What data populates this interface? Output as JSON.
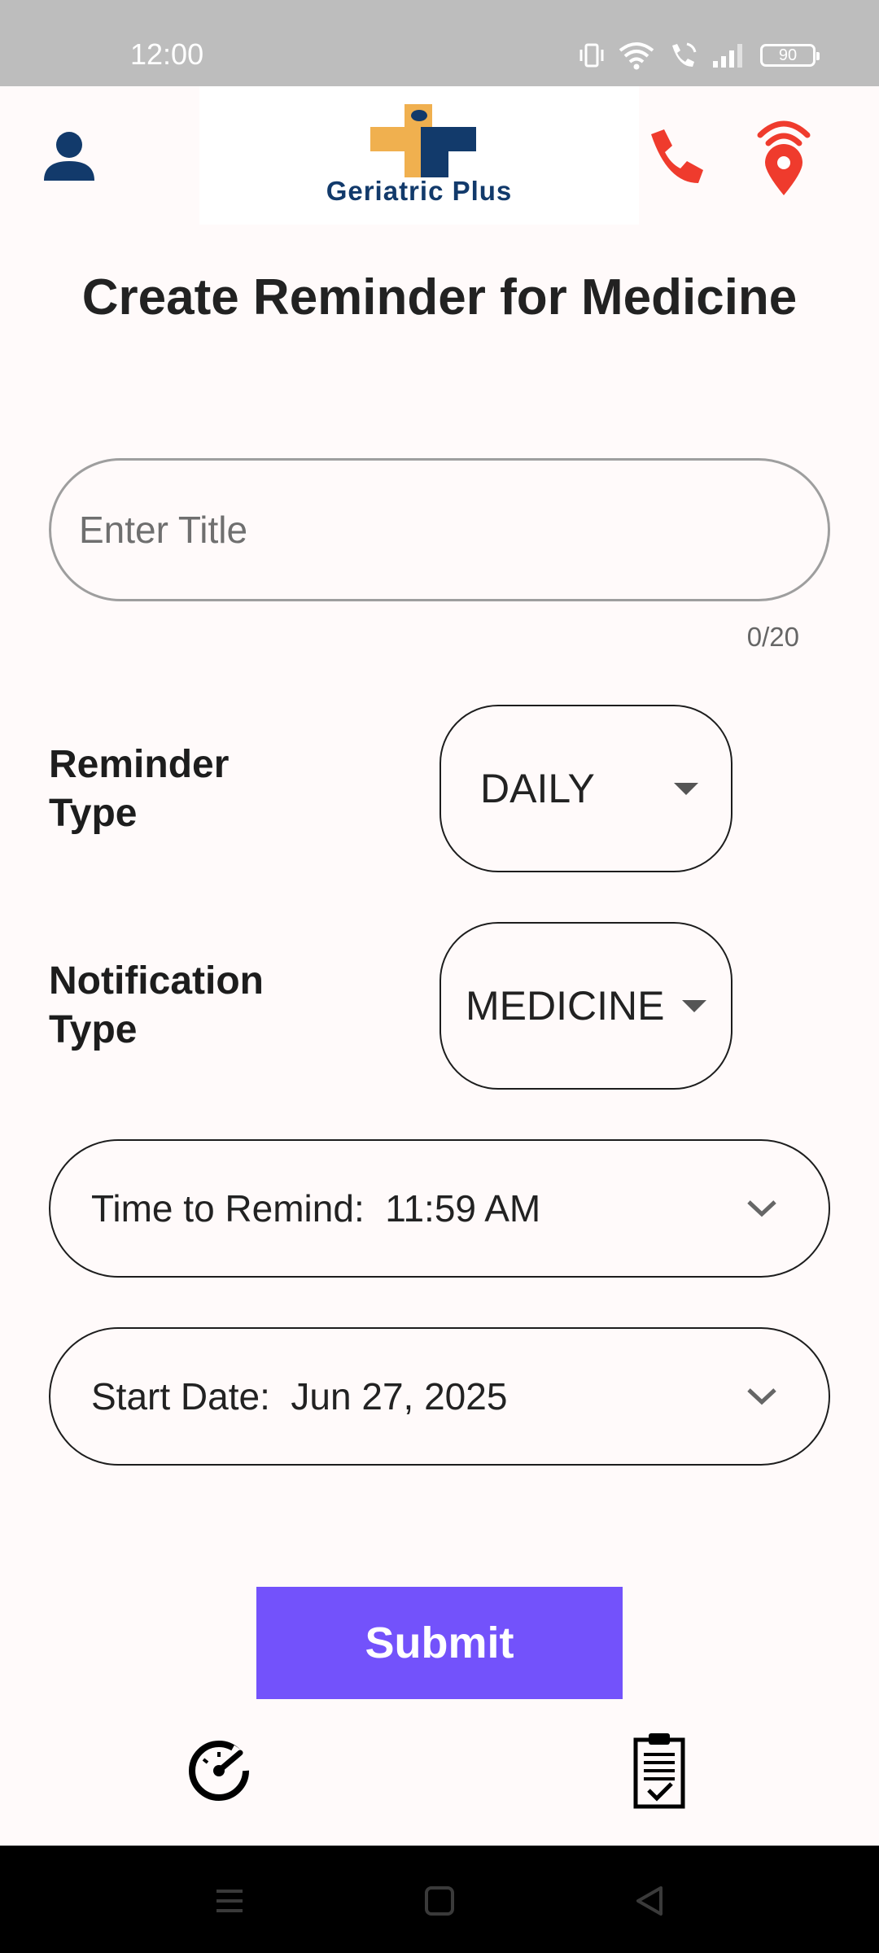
{
  "status_bar": {
    "time": "12:00",
    "battery": "90"
  },
  "header": {
    "logo_text": "Geriatric Plus",
    "colors": {
      "brand_orange": "#f0b04f",
      "brand_navy": "#123a6b",
      "action_red": "#ef3b2d"
    }
  },
  "page": {
    "title": "Create Reminder for Medicine"
  },
  "form": {
    "title_placeholder": "Enter Title",
    "title_value": "",
    "char_counter": "0/20",
    "reminder_type_label_line1": "Reminder",
    "reminder_type_label_line2": "Type",
    "reminder_type_value": "DAILY",
    "notification_type_label_line1": "Notification",
    "notification_type_label_line2": "Type",
    "notification_type_value": "MEDICINE",
    "time_to_remind": "Time to Remind:  11:59 AM",
    "start_date": "Start Date:  Jun 27, 2025",
    "submit_label": "Submit"
  },
  "icons": {
    "profile": "person-icon",
    "call": "phone-icon",
    "location": "location-broadcast-icon",
    "dashboard_tab": "speedometer-icon",
    "reminders_tab": "clipboard-check-icon",
    "accent": "#7352fb"
  }
}
